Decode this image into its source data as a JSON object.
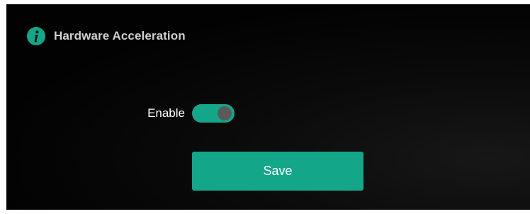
{
  "header": {
    "icon": "info-icon",
    "title": "Hardware Acceleration"
  },
  "form": {
    "enable_label": "Enable",
    "enable_state": true
  },
  "actions": {
    "save_label": "Save"
  },
  "colors": {
    "accent": "#14a689",
    "background": "#050505",
    "knob": "#5a5a5a",
    "title_text": "#cfcfcf"
  }
}
